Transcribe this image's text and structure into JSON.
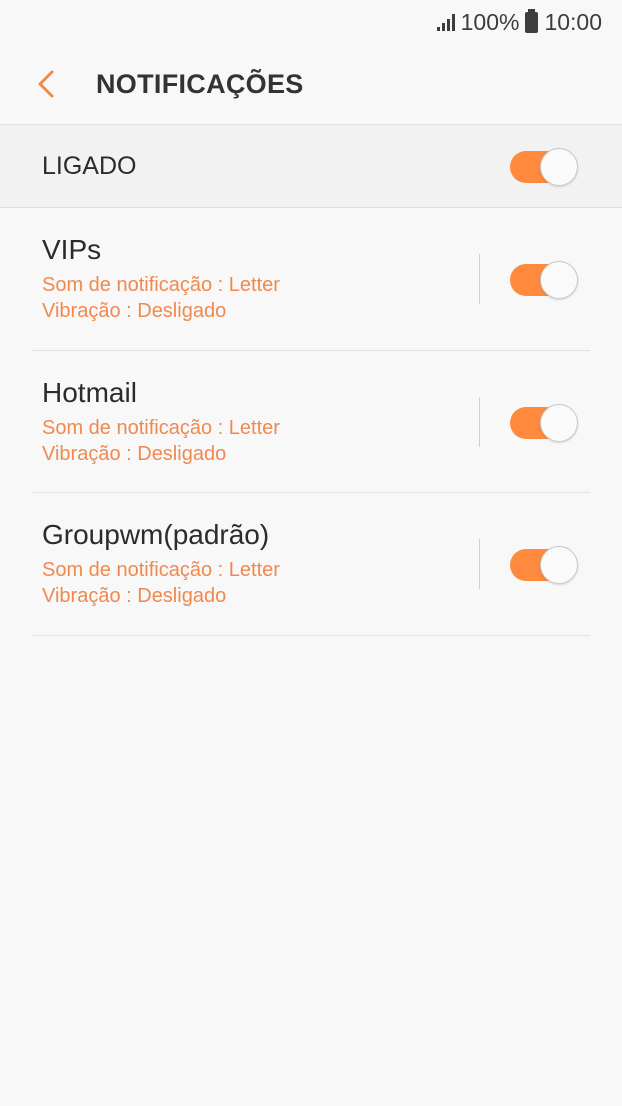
{
  "status_bar": {
    "battery_percent": "100%",
    "time": "10:00"
  },
  "header": {
    "title": "NOTIFICAÇÕES",
    "back_icon": "chevron-left-icon"
  },
  "master_switch": {
    "label": "LIGADO",
    "on": true
  },
  "accounts": [
    {
      "name": "VIPs",
      "sound": "Som de notificação : Letter",
      "vibration": "Vibração : Desligado",
      "on": true
    },
    {
      "name": "Hotmail",
      "sound": "Som de notificação : Letter",
      "vibration": "Vibração : Desligado",
      "on": true
    },
    {
      "name": "Groupwm(padrão)",
      "sound": "Som de notificação : Letter",
      "vibration": "Vibração : Desligado",
      "on": true
    }
  ],
  "colors": {
    "accent": "#ff8a3d",
    "subtitle": "#f0894e",
    "background": "#f8f8f8"
  }
}
